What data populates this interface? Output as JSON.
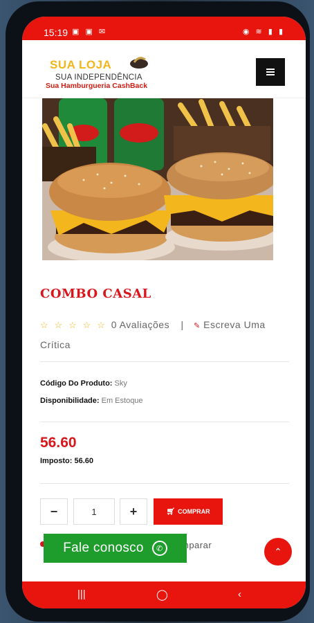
{
  "statusbar": {
    "time": "15:19",
    "left_icons": "▣ ▣ ✉",
    "right_icons": "◉ ≋ ▮ ▮"
  },
  "logo": {
    "line1": "SUA LOJA",
    "line2": "SUA INDEPENDÊNCIA",
    "line3": "Sua Hamburgueria CashBack"
  },
  "product": {
    "title": "COMBO CASAL",
    "stars": [
      "☆",
      "☆",
      "☆",
      "☆",
      "☆"
    ],
    "reviews": "0 Avaliações",
    "separator": "|",
    "write_review": "Escreva Uma Crítica",
    "code_label": "Código Do Produto:",
    "code_value": "Sky",
    "availability_label": "Disponibilidade:",
    "availability_value": "Em Estoque",
    "price": "56.60",
    "tax": "Imposto: 56.60",
    "quantity": "1",
    "buy_label": "COMPRAR",
    "compare_label": "mparar"
  },
  "contact": {
    "label": "Fale conosco"
  },
  "colors": {
    "brand_red": "#e8150f",
    "whatsapp_green": "#1e9c2c",
    "logo_yellow": "#f2b51c"
  },
  "icons": {
    "menu": "menu-icon",
    "cart": "cart-icon",
    "whatsapp": "whatsapp-icon",
    "up": "chevron-up-icon"
  }
}
